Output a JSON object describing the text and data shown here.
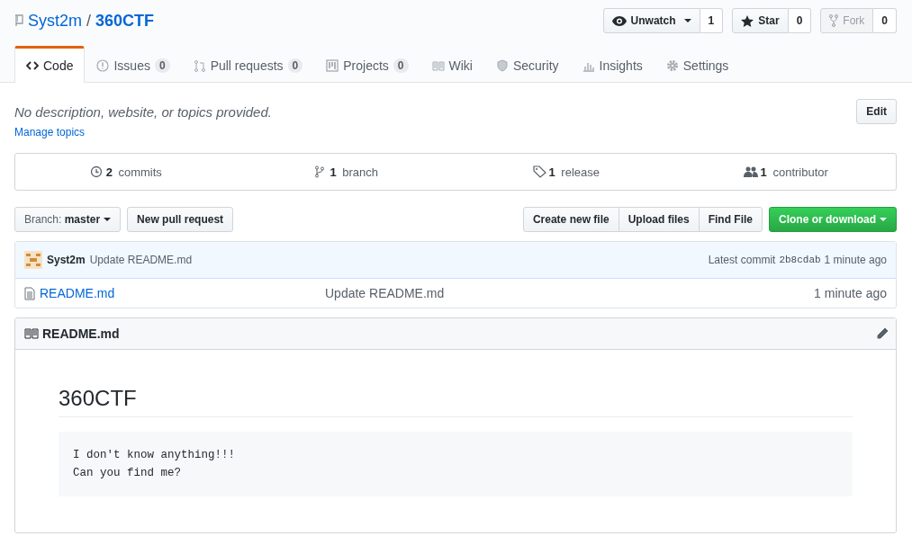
{
  "repo": {
    "owner": "Syst2m",
    "separator": "/",
    "name": "360CTF"
  },
  "actions": [
    {
      "label": "Unwatch",
      "count": "1",
      "dropdown": true,
      "disabled": false
    },
    {
      "label": "Star",
      "count": "0",
      "dropdown": false,
      "disabled": false
    },
    {
      "label": "Fork",
      "count": "0",
      "dropdown": false,
      "disabled": true
    }
  ],
  "tabs": [
    {
      "label": "Code",
      "selected": true
    },
    {
      "label": "Issues",
      "count": "0",
      "selected": false
    },
    {
      "label": "Pull requests",
      "count": "0",
      "selected": false
    },
    {
      "label": "Projects",
      "count": "0",
      "selected": false
    },
    {
      "label": "Wiki",
      "selected": false
    },
    {
      "label": "Security",
      "selected": false
    },
    {
      "label": "Insights",
      "selected": false
    },
    {
      "label": "Settings",
      "selected": false
    }
  ],
  "description": "No description, website, or topics provided.",
  "manage_topics": "Manage topics",
  "edit_button": "Edit",
  "summary": [
    {
      "count": "2",
      "label": "commits"
    },
    {
      "count": "1",
      "label": "branch"
    },
    {
      "count": "1",
      "label": "release"
    },
    {
      "count": "1",
      "label": "contributor"
    }
  ],
  "branch": {
    "prefix": "Branch:",
    "name": "master"
  },
  "new_pull_request": "New pull request",
  "file_buttons": [
    "Create new file",
    "Upload files",
    "Find File"
  ],
  "clone_button": "Clone or download",
  "commit": {
    "author": "Syst2m",
    "message": "Update README.md",
    "latest_label": "Latest commit",
    "sha": "2b8cdab",
    "time": "1 minute ago"
  },
  "files": [
    {
      "name": "README.md",
      "message": "Update README.md",
      "time": "1 minute ago"
    }
  ],
  "readme": {
    "filename": "README.md",
    "heading": "360CTF",
    "code_lines": [
      "I don't know anything!!!",
      "Can you find me?"
    ]
  }
}
